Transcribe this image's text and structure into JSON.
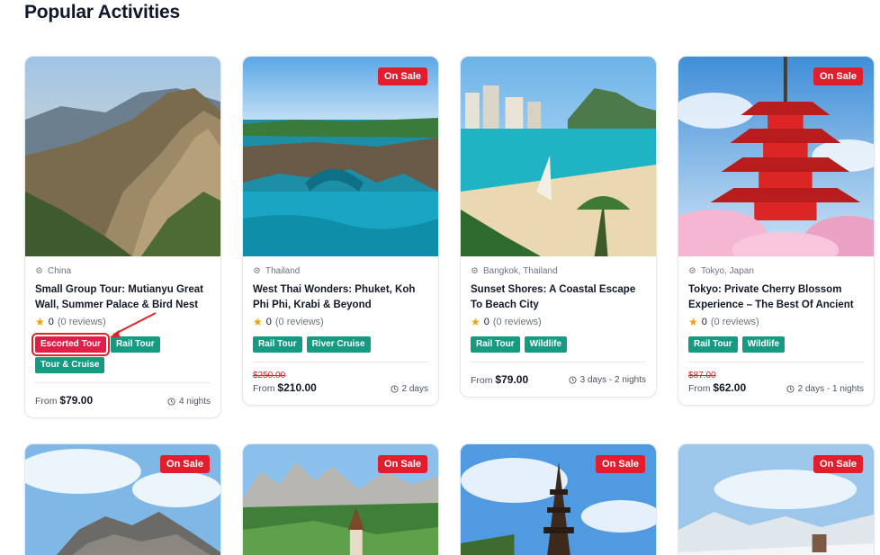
{
  "section_title": "Popular Activities",
  "colors": {
    "sale": "#e11d2e",
    "tag": "#159b82",
    "tag_highlight": "#e11d48",
    "annotation": "#dc2626"
  },
  "cards": [
    {
      "location": "China",
      "title": "Small Group Tour: Mutianyu Great Wall, Summer Palace & Bird Nest",
      "rating": "0",
      "reviews": "(0 reviews)",
      "tags": [
        "Escorted Tour",
        "Rail Tour",
        "Tour & Cruise"
      ],
      "old_price": "",
      "from": "From",
      "price": "$79.00",
      "duration": "4 nights",
      "sale": ""
    },
    {
      "location": "Thailand",
      "title": "West Thai Wonders: Phuket, Koh Phi Phi, Krabi & Beyond",
      "rating": "0",
      "reviews": "(0 reviews)",
      "tags": [
        "Rail Tour",
        "River Cruise"
      ],
      "old_price": "$250.00",
      "from": "From",
      "price": "$210.00",
      "duration": "2 days",
      "sale": "On Sale"
    },
    {
      "location": "Bangkok, Thailand",
      "title": "Sunset Shores: A Coastal Escape To Beach City",
      "rating": "0",
      "reviews": "(0 reviews)",
      "tags": [
        "Rail Tour",
        "Wildlife"
      ],
      "old_price": "",
      "from": "From",
      "price": "$79.00",
      "duration": "3 days - 2 nights",
      "sale": ""
    },
    {
      "location": "Tokyo, Japan",
      "title": "Tokyo: Private Cherry Blossom Experience – The Best Of Ancient ...",
      "rating": "0",
      "reviews": "(0 reviews)",
      "tags": [
        "Rail Tour",
        "Wildlife"
      ],
      "old_price": "$87.00",
      "from": "From",
      "price": "$62.00",
      "duration": "2 days - 1 nights",
      "sale": "On Sale"
    }
  ],
  "bottom_cards": [
    {
      "sale": "On Sale"
    },
    {
      "sale": "On Sale"
    },
    {
      "sale": "On Sale"
    },
    {
      "sale": "On Sale"
    }
  ]
}
